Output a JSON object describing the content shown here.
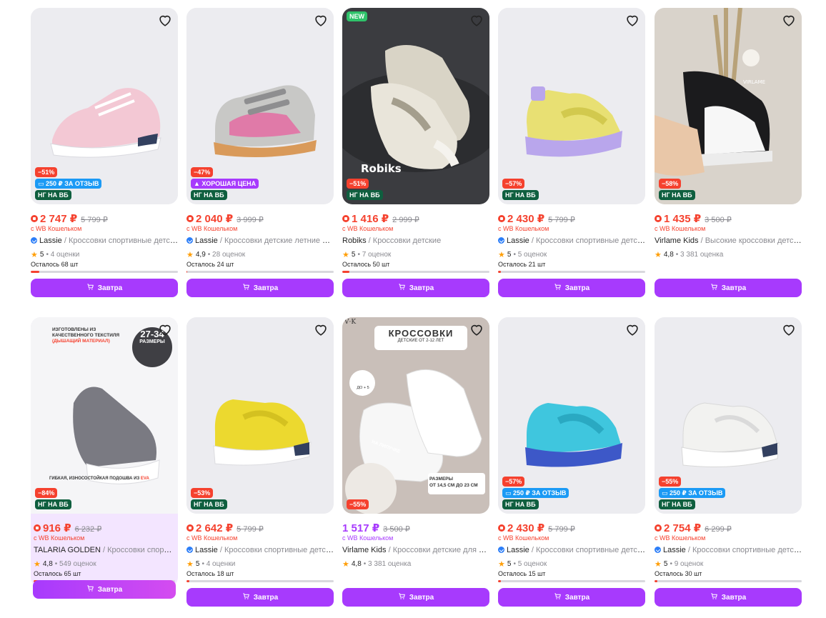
{
  "currency": "₽",
  "products": [
    {
      "badges": [
        {
          "text": "−51%",
          "kind": "disc"
        },
        {
          "text": "250 ₽ ЗА ОТЗЫВ",
          "kind": "rev"
        },
        {
          "text": "НГ НА ВБ",
          "kind": "ng"
        }
      ],
      "price": "2 747 ₽",
      "old_price": "5 799 ₽",
      "wallet": "с WB Кошельком",
      "brand": "Lassie",
      "verified": true,
      "title": " / Кроссовки спортивные детские",
      "rating": "5",
      "reviews": "• 4 оценки",
      "stock": "Осталось 68 шт",
      "stock_level": 0.06,
      "button": "Завтра"
    },
    {
      "badges": [
        {
          "text": "−47%",
          "kind": "disc"
        },
        {
          "text": "ХОРОШАЯ ЦЕНА",
          "kind": "good"
        },
        {
          "text": "НГ НА ВБ",
          "kind": "ng"
        }
      ],
      "price": "2 040 ₽",
      "old_price": "3 999 ₽",
      "wallet": "с WB Кошельком",
      "brand": "Lassie",
      "verified": true,
      "title": " / Кроссовки детские летние на липучке",
      "rating": "4,9",
      "reviews": "• 28 оценок",
      "stock": "Осталось 24 шт",
      "stock_level": 0.0,
      "button": "Завтра"
    },
    {
      "new": "NEW",
      "badges": [
        {
          "text": "−51%",
          "kind": "disc"
        },
        {
          "text": "НГ НА ВБ",
          "kind": "ng"
        }
      ],
      "price": "1 416 ₽",
      "old_price": "2 999 ₽",
      "wallet": "с WB Кошельком",
      "brand": "Robiks",
      "verified": false,
      "title": " / Кроссовки детские",
      "rating": "5",
      "reviews": "• 7 оценок",
      "stock": "Осталось 50 шт",
      "stock_level": 0.05,
      "button": "Завтра"
    },
    {
      "badges": [
        {
          "text": "−57%",
          "kind": "disc"
        },
        {
          "text": "НГ НА ВБ",
          "kind": "ng"
        }
      ],
      "price": "2 430 ₽",
      "old_price": "5 799 ₽",
      "wallet": "с WB Кошельком",
      "brand": "Lassie",
      "verified": true,
      "title": " / Кроссовки спортивные детские",
      "rating": "5",
      "reviews": "• 5 оценок",
      "stock": "Осталось 21 шт",
      "stock_level": 0.02,
      "button": "Завтра"
    },
    {
      "badges": [
        {
          "text": "−58%",
          "kind": "disc"
        },
        {
          "text": "НГ НА ВБ",
          "kind": "ng"
        }
      ],
      "price": "1 435 ₽",
      "old_price": "3 500 ₽",
      "wallet": "с WB Кошельком",
      "brand": "Virlame Kids",
      "verified": false,
      "title": " / Высокие кроссовки детские",
      "rating": "4,8",
      "reviews": "• 3 381 оценка",
      "stock": "",
      "stock_level": null,
      "button": "Завтра"
    },
    {
      "promo": true,
      "badges": [
        {
          "text": "−84%",
          "kind": "disc"
        },
        {
          "text": "НГ НА ВБ",
          "kind": "ng"
        }
      ],
      "price": "916 ₽",
      "old_price": "6 232 ₽",
      "wallet": "с WB Кошельком",
      "brand": "TALARIA GOLDEN",
      "verified": false,
      "title": " / Кроссовки спортивные",
      "rating": "4,8",
      "reviews": "• 549 оценок",
      "stock": "Осталось 65 шт",
      "stock_level": 0.06,
      "button": "Завтра",
      "img_text": {
        "top": "ИЗГОТОВЛЕНЫ ИЗ КАЧЕСТВЕННОГО ТЕКСТИЛЯ",
        "top_accent": "(ДЫШАЩИЙ МАТЕРИАЛ)",
        "sizes": "27-34",
        "sizes_label": "РАЗМЕРЫ",
        "bottom": "ГИБКАЯ, ИЗНОСОСТОЙКАЯ ПОДОШВА ИЗ",
        "bottom_accent": "EVA"
      }
    },
    {
      "badges": [
        {
          "text": "−53%",
          "kind": "disc"
        },
        {
          "text": "НГ НА ВБ",
          "kind": "ng"
        }
      ],
      "price": "2 642 ₽",
      "old_price": "5 799 ₽",
      "wallet": "с WB Кошельком",
      "brand": "Lassie",
      "verified": true,
      "title": " / Кроссовки спортивные детские",
      "rating": "5",
      "reviews": "• 4 оценки",
      "stock": "Осталось 18 шт",
      "stock_level": 0.02,
      "button": "Завтра"
    },
    {
      "violet": true,
      "badges": [
        {
          "text": "−55%",
          "kind": "disc"
        }
      ],
      "price": "1 517 ₽",
      "old_price": "3 500 ₽",
      "wallet": "с WB Кошельком",
      "brand": "Virlame Kids",
      "verified": false,
      "title": " / Кроссовки детские для мальчика",
      "rating": "4,8",
      "reviews": "• 3 381 оценка",
      "stock": "",
      "stock_level": null,
      "button": "Завтра",
      "img_text": {
        "logo": "V·K",
        "head": "КРОССОВКИ",
        "sub": "ДЕТСКИЕ ОТ 2-12 ЛЕТ",
        "wash": "ДО + 5",
        "velcro": "НА ЛИПУЧКЕ",
        "sizes": "РАЗМЕРЫ",
        "sizes_range": "ОТ 14,5 СМ ДО 23 СМ"
      }
    },
    {
      "badges": [
        {
          "text": "−57%",
          "kind": "disc"
        },
        {
          "text": "250 ₽ ЗА ОТЗЫВ",
          "kind": "rev"
        },
        {
          "text": "НГ НА ВБ",
          "kind": "ng"
        }
      ],
      "price": "2 430 ₽",
      "old_price": "5 799 ₽",
      "wallet": "с WB Кошельком",
      "brand": "Lassie",
      "verified": true,
      "title": " / Кроссовки спортивные детские",
      "rating": "5",
      "reviews": "• 5 оценок",
      "stock": "Осталось 15 шт",
      "stock_level": 0.02,
      "button": "Завтра"
    },
    {
      "badges": [
        {
          "text": "−55%",
          "kind": "disc"
        },
        {
          "text": "250 ₽ ЗА ОТЗЫВ",
          "kind": "rev"
        },
        {
          "text": "НГ НА ВБ",
          "kind": "ng"
        }
      ],
      "price": "2 754 ₽",
      "old_price": "6 299 ₽",
      "wallet": "с WB Кошельком",
      "brand": "Lassie",
      "verified": true,
      "title": " / Кроссовки спортивные детские",
      "rating": "5",
      "reviews": "• 9 оценок",
      "stock": "Осталось 30 шт",
      "stock_level": 0.02,
      "button": "Завтра"
    }
  ],
  "colors": {
    "accent": "#a73afd",
    "discount": "#f5412e",
    "review": "#1b9af5",
    "ng": "#0f5f3f",
    "star": "#ff9f0a"
  },
  "icons": {
    "favorite": "heart-outline-icon",
    "cart": "cart-icon",
    "wallet": "wallet-icon",
    "verified": "verified-check-icon",
    "star": "star-icon"
  }
}
